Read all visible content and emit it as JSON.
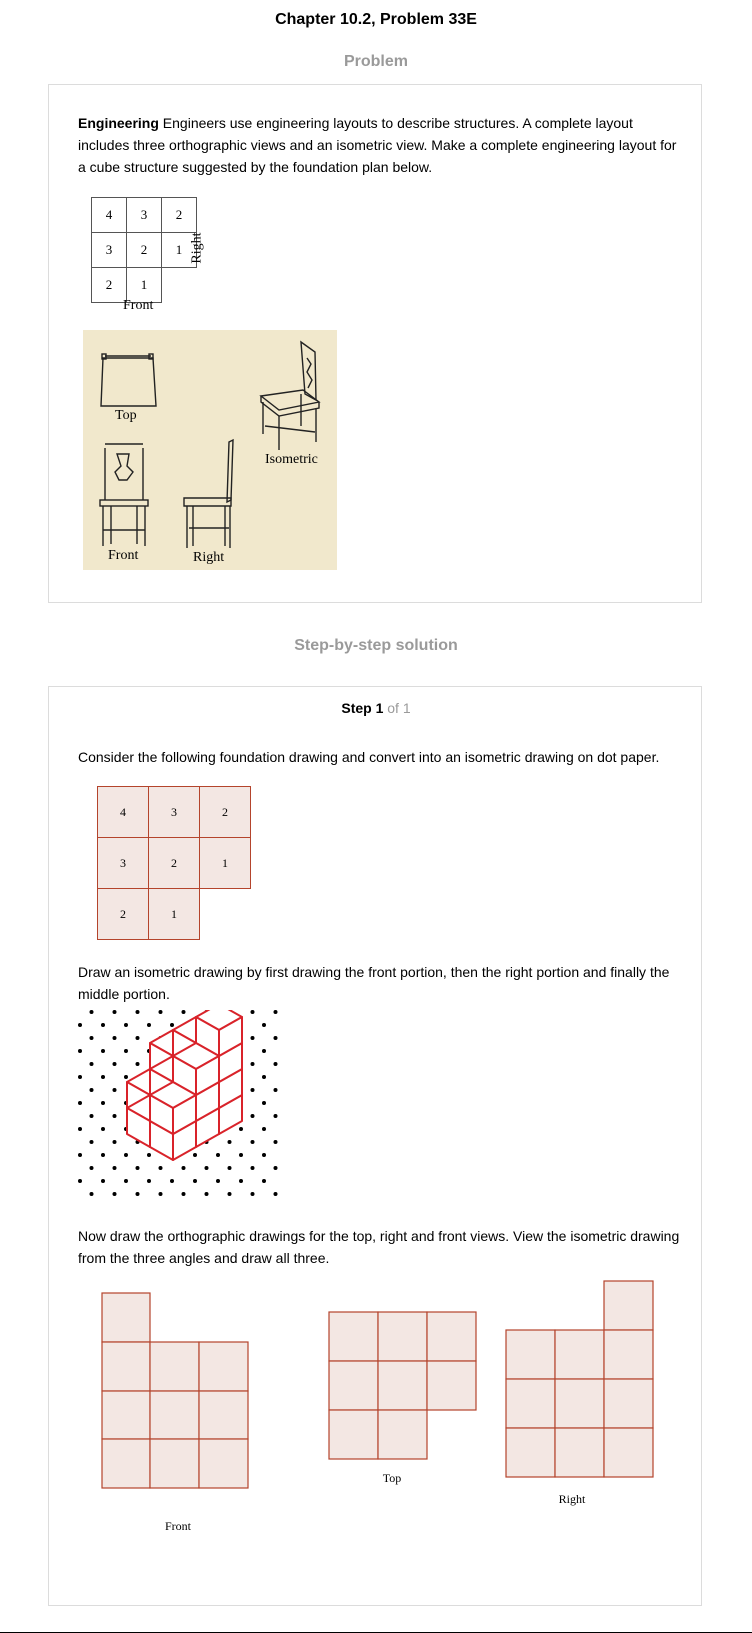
{
  "header": {
    "title": "Chapter 10.2, Problem 33E"
  },
  "problem": {
    "section_title": "Problem",
    "bold_lead": "Engineering",
    "text": " Engineers use engineering layouts to describe structures. A complete layout includes three orthographic views and an isometric view. Make a complete engineering layout for a cube structure suggested by the foundation plan below.",
    "plan": {
      "rows": [
        [
          "4",
          "3",
          "2"
        ],
        [
          "3",
          "2",
          "1"
        ],
        [
          "2",
          "1",
          ""
        ]
      ],
      "front_label": "Front",
      "right_label": "Right"
    },
    "chair_figure": {
      "top_label": "Top",
      "isometric_label": "Isometric",
      "front_label": "Front",
      "right_label": "Right",
      "background_color": "#f1e8cc"
    }
  },
  "solution": {
    "section_title": "Step-by-step solution",
    "step_label": "Step 1",
    "step_of": " of 1",
    "text1": "Consider the following foundation drawing and convert into an isometric drawing on dot paper.",
    "foundation": {
      "rows": [
        [
          "4",
          "3",
          "2"
        ],
        [
          "3",
          "2",
          "1"
        ],
        [
          "2",
          "1",
          ""
        ]
      ]
    },
    "text2": "Draw an isometric drawing by first drawing the front portion, then the right portion and finally the middle portion.",
    "text3": "Now draw the orthographic drawings for the top, right and front views. View the isometric drawing from the three angles and draw all three.",
    "views": {
      "front_label": "Front",
      "top_label": "Top",
      "right_label": "Right"
    },
    "colors": {
      "cell_fill": "#f3e7e3",
      "cell_border": "#b4442c",
      "cube_line": "#d9232a",
      "dot": "#000000"
    }
  }
}
